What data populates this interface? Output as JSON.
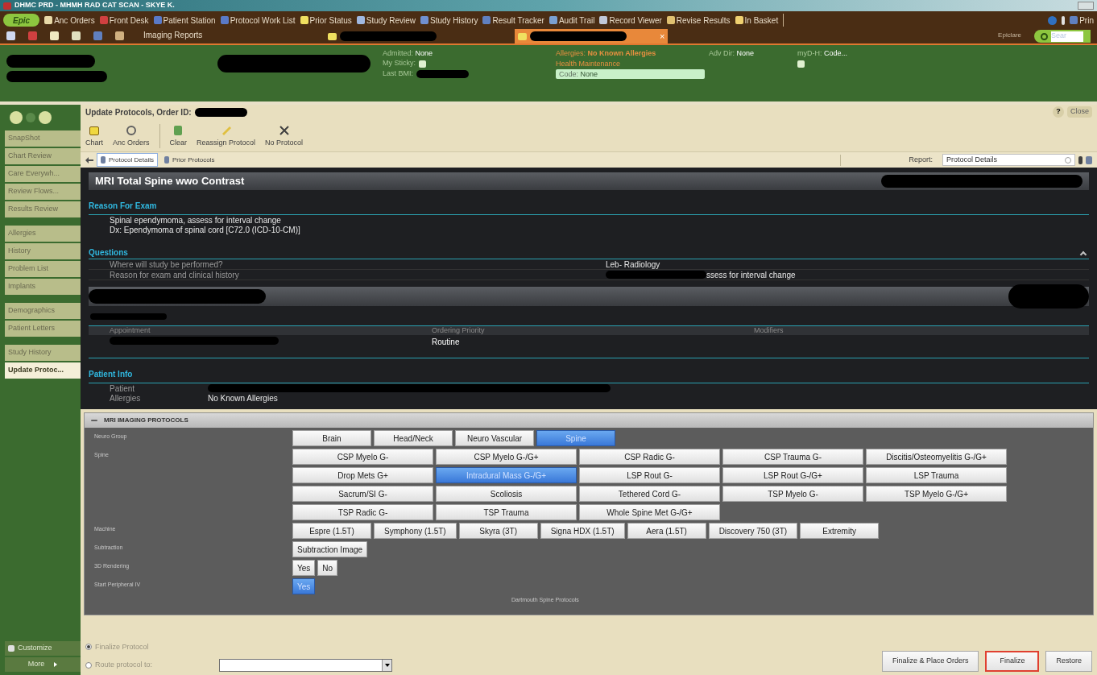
{
  "window": {
    "title": "DHMC PRD - MHMH RAD CAT SCAN - SKYE K."
  },
  "toolbar": {
    "logo": "Epic",
    "items": [
      {
        "label": "Anc Orders"
      },
      {
        "label": "Front Desk"
      },
      {
        "label": "Patient Station"
      },
      {
        "label": "Protocol Work List"
      },
      {
        "label": "Prior Status"
      },
      {
        "label": "Study Review"
      },
      {
        "label": "Study History"
      },
      {
        "label": "Result Tracker"
      },
      {
        "label": "Audit Trail"
      },
      {
        "label": "Record Viewer"
      },
      {
        "label": "Revise Results"
      },
      {
        "label": "In Basket"
      }
    ],
    "right_label": "Prin"
  },
  "secondary_bar": {
    "activity": "Imaging Reports",
    "tabs": [
      {
        "selected": false,
        "closable": false
      },
      {
        "selected": true,
        "closable": true
      }
    ],
    "close_glyph": "×",
    "user": "Epiclare",
    "search": {
      "placeholder": "Sear"
    }
  },
  "patient_header": {
    "columns": [
      [
        {
          "kind": "text",
          "label": "Admitted:",
          "value": "None"
        },
        {
          "kind": "icon",
          "label": "My Sticky:"
        },
        {
          "kind": "redacted",
          "label": "Last BMI:"
        }
      ],
      [
        {
          "kind": "alert",
          "label": "Allergies:",
          "value": "No Known Allergies"
        },
        {
          "kind": "alert",
          "label": "Health Maintenance"
        },
        {
          "kind": "code",
          "label": "Code:",
          "value": "None"
        }
      ],
      [
        {
          "kind": "text",
          "label": "Adv Dir:",
          "value": "None"
        }
      ],
      [
        {
          "kind": "text",
          "label": "myD-H:",
          "value": "Code..."
        },
        {
          "kind": "icon"
        }
      ]
    ]
  },
  "sidebar": {
    "groups": [
      [
        {
          "label": "SnapShot",
          "selected": false
        },
        {
          "label": "Chart Review",
          "selected": false
        },
        {
          "label": "Care Everywh...",
          "selected": false
        },
        {
          "label": "Review Flows...",
          "selected": false
        },
        {
          "label": "Results Review",
          "selected": false
        }
      ],
      [
        {
          "label": "Allergies",
          "selected": false
        },
        {
          "label": "History",
          "selected": false
        },
        {
          "label": "Problem List",
          "selected": false
        },
        {
          "label": "Implants",
          "selected": false
        }
      ],
      [
        {
          "label": "Demographics",
          "selected": false
        },
        {
          "label": "Patient Letters",
          "selected": false
        }
      ],
      [
        {
          "label": "Study History",
          "selected": false
        },
        {
          "label": "Update Protoc...",
          "selected": true
        }
      ]
    ],
    "customize": "Customize",
    "more": "More"
  },
  "activity": {
    "title": "Update Protocols, Order ID:",
    "help": "?",
    "close": "Close",
    "tool_groups": [
      [
        {
          "label": "Chart",
          "kind": "chart"
        },
        {
          "label": "Anc Orders",
          "kind": "orders"
        }
      ],
      [
        {
          "label": "Clear",
          "kind": "clear"
        },
        {
          "label": "Reassign Protocol",
          "kind": "reassign"
        },
        {
          "label": "No Protocol",
          "kind": "none"
        }
      ]
    ],
    "tabs": [
      {
        "label": "Protocol Details",
        "selected": true
      },
      {
        "label": "Prior Protocols",
        "selected": false
      }
    ],
    "report": {
      "label": "Report:",
      "value": "Protocol Details"
    }
  },
  "report_view": {
    "title": "MRI Total Spine wwo Contrast",
    "reason": {
      "heading": "Reason For Exam",
      "lines": [
        "Spinal ependymoma, assess for interval change",
        "Dx: Ependymoma of spinal cord [C72.0 (ICD-10-CM)]"
      ]
    },
    "questions": {
      "heading": "Questions",
      "rows": [
        {
          "question": "Where will study be performed?",
          "answer": "Leb- Radiology",
          "redacted": false
        },
        {
          "question": "Reason for exam and clinical history",
          "answer": "ssess for interval change",
          "redacted": true
        }
      ]
    },
    "order": {
      "columns": [
        {
          "label": "Appointment"
        },
        {
          "label": "Ordering Priority",
          "value": "Routine"
        },
        {
          "label": "Modifiers"
        }
      ]
    },
    "patient_info": {
      "heading": "Patient Info",
      "rows": [
        {
          "label": "Patient"
        },
        {
          "label": "Allergies",
          "value": "No Known Allergies"
        }
      ]
    }
  },
  "protocols": {
    "title": "MRI IMAGING PROTOCOLS",
    "groups": [
      {
        "label": "Neuro Group",
        "kind": "flow",
        "options": [
          {
            "label": "Brain",
            "selected": false
          },
          {
            "label": "Head/Neck",
            "selected": false
          },
          {
            "label": "Neuro Vascular",
            "selected": false
          },
          {
            "label": "Spine",
            "selected": true
          }
        ]
      },
      {
        "label": "Spine",
        "kind": "grid",
        "options": [
          {
            "label": "CSP Myelo G-",
            "selected": false
          },
          {
            "label": "CSP Myelo G-/G+",
            "selected": false
          },
          {
            "label": "CSP Radic G-",
            "selected": false
          },
          {
            "label": "CSP Trauma G-",
            "selected": false
          },
          {
            "label": "Discitis/Osteomyelitis G-/G+",
            "selected": false
          },
          {
            "label": "Drop Mets G+",
            "selected": false
          },
          {
            "label": "Intradural Mass G-/G+",
            "selected": true
          },
          {
            "label": "LSP Rout G-",
            "selected": false
          },
          {
            "label": "LSP Rout G-/G+",
            "selected": false
          },
          {
            "label": "LSP Trauma",
            "selected": false
          },
          {
            "label": "Sacrum/SI G-",
            "selected": false
          },
          {
            "label": "Scoliosis",
            "selected": false
          },
          {
            "label": "Tethered Cord G-",
            "selected": false
          },
          {
            "label": "TSP Myelo G-",
            "selected": false
          },
          {
            "label": "TSP Myelo G-/G+",
            "selected": false
          },
          {
            "label": "TSP Radic G-",
            "selected": false
          },
          {
            "label": "TSP Trauma",
            "selected": false
          },
          {
            "label": "Whole Spine Met G-/G+",
            "selected": false
          }
        ]
      },
      {
        "label": "Machine",
        "kind": "flow",
        "options": [
          {
            "label": "Espre (1.5T)",
            "selected": false
          },
          {
            "label": "Symphony (1.5T)",
            "selected": false
          },
          {
            "label": "Skyra (3T)",
            "selected": false
          },
          {
            "label": "Signa HDX (1.5T)",
            "selected": false
          },
          {
            "label": "Aera (1.5T)",
            "selected": false
          },
          {
            "label": "Discovery 750 (3T)",
            "selected": false
          },
          {
            "label": "Extremity",
            "selected": false
          }
        ]
      },
      {
        "label": "Subtraction",
        "kind": "flow",
        "options": [
          {
            "label": "Subtraction Image",
            "selected": false
          }
        ]
      },
      {
        "label": "3D Rendering",
        "kind": "flow",
        "options": [
          {
            "label": "Yes",
            "selected": false
          },
          {
            "label": "No",
            "selected": false
          }
        ]
      },
      {
        "label": "Start Peripheral IV",
        "kind": "flow",
        "options": [
          {
            "label": "Yes",
            "selected": true
          }
        ]
      }
    ],
    "footer_text": "Dartmouth Spine Protocols"
  },
  "finalize": {
    "options": [
      {
        "label": "Finalize Protocol",
        "selected": true,
        "kind": "plain"
      },
      {
        "label": "Route protocol to:",
        "selected": false,
        "kind": "dropdown"
      }
    ],
    "buttons": [
      {
        "label": "Finalize & Place Orders",
        "focused": false
      },
      {
        "label": "Finalize",
        "focused": true
      },
      {
        "label": "Restore",
        "focused": false
      }
    ]
  }
}
